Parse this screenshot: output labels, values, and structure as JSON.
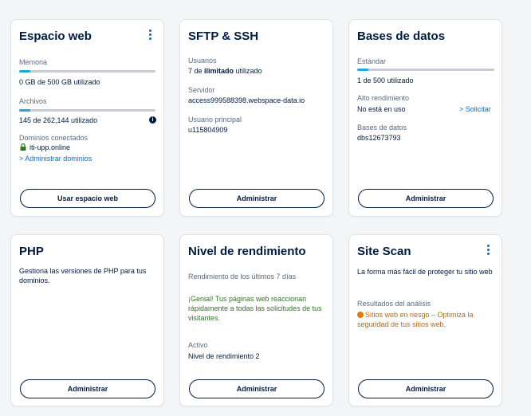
{
  "cards": {
    "espacio_web": {
      "title": "Espacio web",
      "memoria_label": "Memoria",
      "memoria_usage": "0 GB de 500 GB utilizado",
      "memoria_progress": 0.08,
      "archivos_label": "Archivos",
      "archivos_usage": "145 de 262,144 utilizado",
      "archivos_progress": 0.08,
      "dominios_label": "Dominios conectados",
      "domain": "iti-upp.online",
      "manage_domains_link": "> Administrar dominios",
      "button": "Usar espacio web"
    },
    "sftp": {
      "title": "SFTP & SSH",
      "usuarios_label": "Usuarios",
      "usuarios_prefix": "7 de ",
      "usuarios_bold": "ilimitado",
      "usuarios_suffix": " utilizado",
      "servidor_label": "Servidor",
      "servidor_value": "access999588398.webspace-data.io",
      "usuario_principal_label": "Usuario principal",
      "usuario_principal_value": "u115804909",
      "button": "Administrar"
    },
    "bases_datos": {
      "title": "Bases de datos",
      "estandar_label": "Estándar",
      "estandar_usage": "1 de 500 utilizado",
      "estandar_progress": 0.08,
      "alto_label": "Alto rendimiento",
      "alto_value": "No está en uso",
      "solicitar_link": "> Solicitar",
      "bases_label": "Bases de datos",
      "bases_value": "dbs12673793",
      "button": "Administrar"
    },
    "php": {
      "title": "PHP",
      "description": "Gestiona las versiones de PHP para tus dominios.",
      "button": "Administrar"
    },
    "rendimiento": {
      "title": "Nivel de rendimiento",
      "rend_label": "Rendimiento de los últimos 7 días",
      "rend_message": "¡Genial! Tus páginas web reaccionan rápidamente a todas las solicitudes de tus visitantes.",
      "activo_label": "Activo",
      "activo_value": "Nivel de rendimiento 2",
      "button": "Administrar"
    },
    "site_scan": {
      "title": "Site Scan",
      "description": "La forma más fácil de proteger tu sitio web",
      "resultados_label": "Resultados del análisis",
      "resultados_value": "Sitios web en riesgo – Optimiza la seguridad de tus sitios web.",
      "button": "Administrar"
    }
  },
  "icons": {
    "kebab": "kebab-menu-icon",
    "info": "info-icon",
    "lock": "lock-icon",
    "warning": "warning-dot-icon"
  },
  "colors": {
    "accent": "#0b6bcb",
    "progress": "#1aa7e8",
    "positive": "#2c7a1b",
    "warning": "#c46a00"
  }
}
